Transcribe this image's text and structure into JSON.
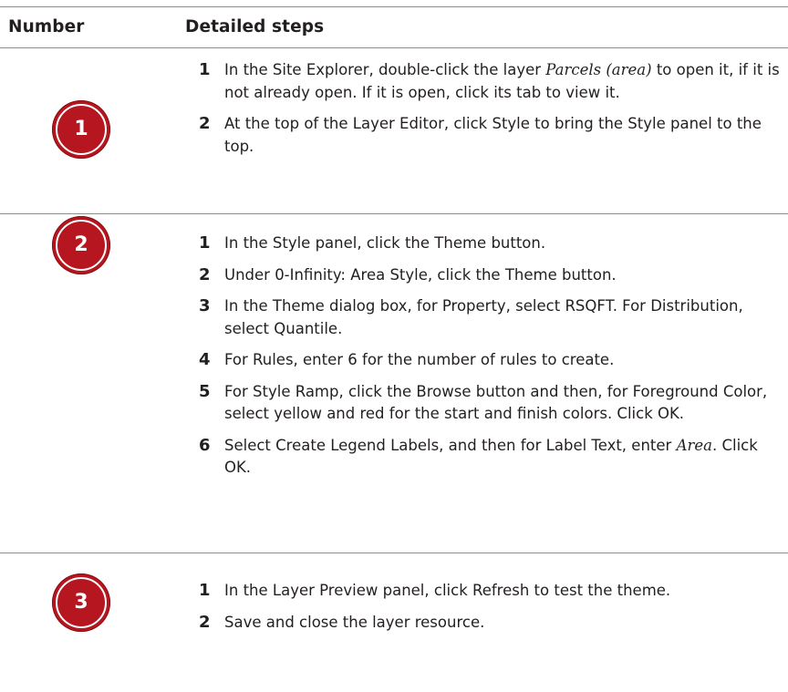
{
  "header": {
    "number_label": "Number",
    "steps_label": "Detailed steps"
  },
  "sections": [
    {
      "number": "1",
      "steps": [
        {
          "num": "1",
          "text_before": "In the Site Explorer, double-click the layer ",
          "text_emph": "Parcels (area)",
          "text_after": "  to open it, if it is not already open. If it is open, click its tab to view it."
        },
        {
          "num": "2",
          "text_before": "At the top of the Layer Editor, click Style to bring the Style panel to the top.",
          "text_emph": "",
          "text_after": ""
        }
      ]
    },
    {
      "number": "2",
      "steps": [
        {
          "num": "1",
          "text_before": "In the Style panel, click the Theme button.",
          "text_emph": "",
          "text_after": ""
        },
        {
          "num": "2",
          "text_before": "Under 0-Infinity: Area Style, click the Theme button.",
          "text_emph": "",
          "text_after": ""
        },
        {
          "num": "3",
          "text_before": "In the Theme dialog box, for Property, select RSQFT. For Distribution, select Quantile.",
          "text_emph": "",
          "text_after": ""
        },
        {
          "num": "4",
          "text_before": "For Rules, enter 6 for the number of rules to create.",
          "text_emph": "",
          "text_after": ""
        },
        {
          "num": "5",
          "text_before": "For Style Ramp, click the Browse button and then, for Foreground Color, select yellow and red for the start and finish colors. Click OK.",
          "text_emph": "",
          "text_after": ""
        },
        {
          "num": "6",
          "text_before": "Select Create Legend Labels, and then for Label Text, enter ",
          "text_emph": "Area",
          "text_after": ". Click OK."
        }
      ]
    },
    {
      "number": "3",
      "steps": [
        {
          "num": "1",
          "text_before": "In the Layer Preview panel, click Refresh to test the theme.",
          "text_emph": "",
          "text_after": ""
        },
        {
          "num": "2",
          "text_before": "Save and close the layer resource.",
          "text_emph": "",
          "text_after": ""
        }
      ]
    }
  ],
  "colors": {
    "badge": "#b5161f",
    "rule": "#8c8c8c",
    "text": "#231f20"
  }
}
